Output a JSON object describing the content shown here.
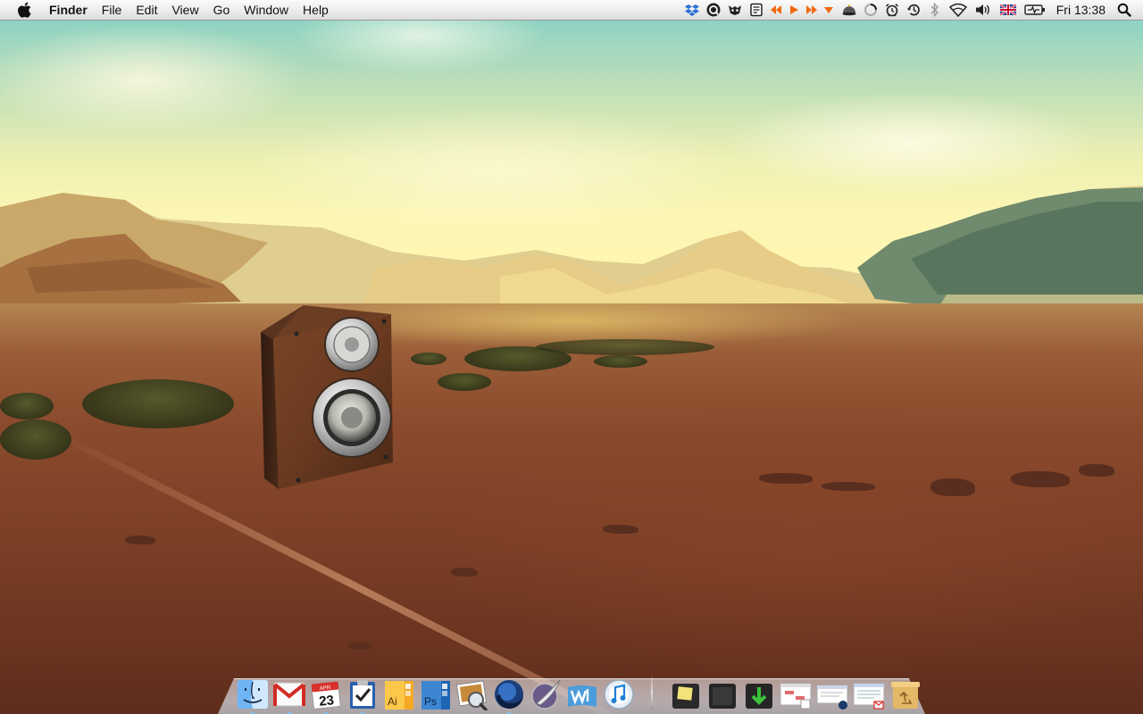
{
  "menubar": {
    "app_name": "Finder",
    "menus": [
      "File",
      "Edit",
      "View",
      "Go",
      "Window",
      "Help"
    ],
    "clock": "Fri 13:38",
    "status_icons": [
      "dropbox-icon",
      "quicksilver-icon",
      "growl-icon",
      "notes-icon",
      "media-previous-icon",
      "media-play-icon",
      "media-next-icon",
      "media-dropdown-icon",
      "eject-icon",
      "spinner-icon",
      "alarm-clock-icon",
      "time-machine-icon",
      "bluetooth-icon",
      "wifi-icon",
      "volume-icon",
      "uk-flag-icon",
      "battery-icon"
    ]
  },
  "calendar_icon": {
    "month": "APR",
    "day": "23"
  },
  "illustrator_icon": {
    "label": "Ai"
  },
  "photoshop_icon": {
    "label": "Ps"
  },
  "dock": {
    "apps": [
      {
        "name": "finder-icon",
        "running": true
      },
      {
        "name": "gmail-icon",
        "running": true
      },
      {
        "name": "calendar-icon",
        "running": true
      },
      {
        "name": "tasks-icon",
        "running": true
      },
      {
        "name": "illustrator-icon",
        "running": false
      },
      {
        "name": "photoshop-icon",
        "running": false
      },
      {
        "name": "preview-icon",
        "running": false
      },
      {
        "name": "firefox-icon",
        "running": true
      },
      {
        "name": "quill-icon",
        "running": false
      },
      {
        "name": "word-icon",
        "running": false
      },
      {
        "name": "itunes-icon",
        "running": false
      }
    ],
    "stacks": [
      "notes-stack-icon",
      "documents-stack-icon",
      "downloads-stack-icon",
      "calendar-window-icon",
      "mail-window-icon",
      "gmail-window-icon",
      "trash-icon"
    ]
  },
  "colors": {
    "menubar_text": "#111111",
    "accent_blue": "#2b6fd6",
    "sky_top": "#7fcfc6",
    "horizon": "#fff6a8",
    "desert": "#8a4a2c"
  }
}
